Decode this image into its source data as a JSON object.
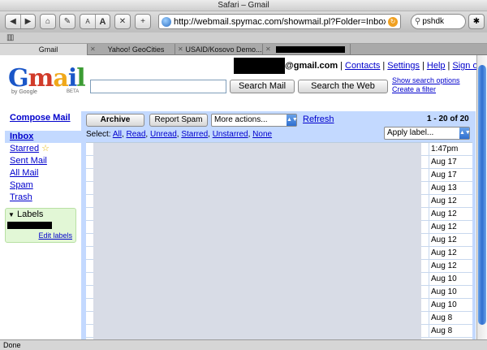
{
  "window": {
    "title": "Safari – Gmail"
  },
  "toolbar": {
    "url": "http://webmail.spymac.com/showmail.pl?Folder=Inbox&uniq",
    "search_value": "pshdk",
    "text_smaller": "A",
    "text_larger": "A"
  },
  "bookmarks": {
    "icon": "book-icon"
  },
  "tabs": [
    {
      "label": "Gmail"
    },
    {
      "label": "Yahoo! GeoCities"
    },
    {
      "label": "USAID/Kosovo Demo..."
    },
    {
      "label": ""
    }
  ],
  "gmail": {
    "logo_text": "Gmail",
    "logo_by": "by Google",
    "logo_beta": "BETA",
    "account_suffix": "@gmail.com",
    "links": {
      "contacts": "Contacts",
      "settings": "Settings",
      "help": "Help",
      "signout": "Sign out"
    },
    "search_mail": "Search Mail",
    "search_web": "Search the Web",
    "show_options": "Show search options",
    "create_filter": "Create a filter",
    "compose": "Compose Mail",
    "nav": [
      "Inbox",
      "Starred",
      "Sent Mail",
      "All Mail",
      "Spam",
      "Trash"
    ],
    "labels_header": "Labels",
    "edit_labels": "Edit labels",
    "archive": "Archive",
    "report_spam": "Report Spam",
    "more_actions": "More actions...",
    "refresh": "Refresh",
    "paging": "1 - 20 of 20",
    "apply_label": "Apply label...",
    "select_line": {
      "prefix": "Select:",
      "options": [
        "All",
        "Read",
        "Unread",
        "Starred",
        "Unstarred",
        "None"
      ]
    },
    "dates": [
      "1:47pm",
      "Aug 17",
      "Aug 17",
      "Aug 13",
      "Aug 12",
      "Aug 12",
      "Aug 12",
      "Aug 12",
      "Aug 12",
      "Aug 12",
      "Aug 10",
      "Aug 10",
      "Aug 10",
      "Aug 8",
      "Aug 8"
    ]
  },
  "status": {
    "text": "Done"
  }
}
